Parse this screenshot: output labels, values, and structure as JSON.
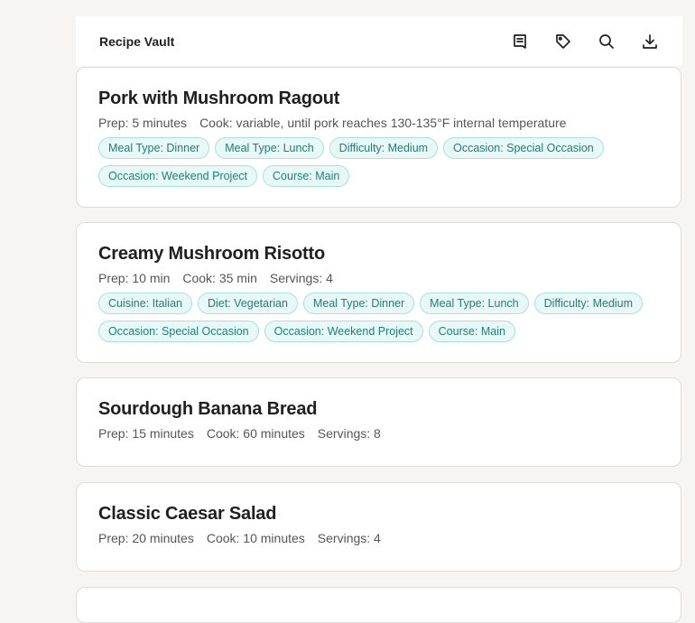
{
  "app": {
    "title": "Recipe Vault"
  },
  "header_icons": [
    "list-icon",
    "tag-icon",
    "search-icon",
    "download-icon"
  ],
  "recipes": [
    {
      "title": "Pork with Mushroom Ragout",
      "prep": "Prep: 5 minutes",
      "cook": "Cook: variable, until pork reaches 130-135°F internal temperature",
      "servings": "",
      "tags": [
        "Meal Type: Dinner",
        "Meal Type: Lunch",
        "Difficulty: Medium",
        "Occasion: Special Occasion",
        "Occasion: Weekend Project",
        "Course: Main"
      ]
    },
    {
      "title": "Creamy Mushroom Risotto",
      "prep": "Prep: 10 min",
      "cook": "Cook: 35 min",
      "servings": "Servings: 4",
      "tags": [
        "Cuisine: Italian",
        "Diet: Vegetarian",
        "Meal Type: Dinner",
        "Meal Type: Lunch",
        "Difficulty: Medium",
        "Occasion: Special Occasion",
        "Occasion: Weekend Project",
        "Course: Main"
      ]
    },
    {
      "title": "Sourdough Banana Bread",
      "prep": "Prep: 15 minutes",
      "cook": "Cook: 60 minutes",
      "servings": "Servings: 8",
      "tags": []
    },
    {
      "title": "Classic Caesar Salad",
      "prep": "Prep: 20 minutes",
      "cook": "Cook: 10 minutes",
      "servings": "Servings: 4",
      "tags": []
    }
  ]
}
